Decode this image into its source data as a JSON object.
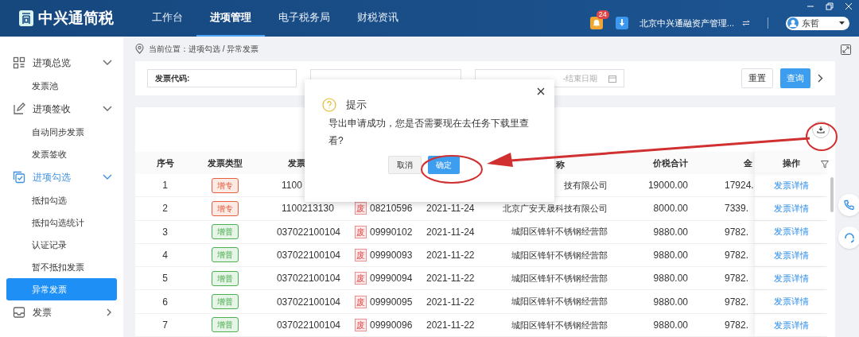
{
  "header": {
    "logo": "中兴通简税",
    "nav": [
      {
        "label": "工作台",
        "selected": false
      },
      {
        "label": "进项管理",
        "selected": true
      },
      {
        "label": "电子税务局",
        "selected": false
      },
      {
        "label": "财税资讯",
        "selected": false
      }
    ],
    "notification_count": "24",
    "company": "北京中兴通融资产管理...",
    "user": "东哲"
  },
  "sidebar": [
    {
      "label": "进项总览",
      "expanded": true,
      "selected": false,
      "children": [
        {
          "label": "发票池",
          "selected": false
        }
      ]
    },
    {
      "label": "进项签收",
      "expanded": true,
      "selected": false,
      "children": [
        {
          "label": "自动同步发票",
          "selected": false
        },
        {
          "label": "发票签收",
          "selected": false
        }
      ]
    },
    {
      "label": "进项勾选",
      "expanded": true,
      "selected": true,
      "children": [
        {
          "label": "抵扣勾选",
          "selected": false
        },
        {
          "label": "抵扣勾选统计",
          "selected": false
        },
        {
          "label": "认证记录",
          "selected": false
        },
        {
          "label": "暂不抵扣发票",
          "selected": false
        },
        {
          "label": "异常发票",
          "selected": true
        }
      ]
    },
    {
      "label": "发票",
      "expanded": false,
      "selected": false
    }
  ],
  "breadcrumb": "当前位置：进项勾选 / 异常发票",
  "filters": [
    {
      "kind": "text",
      "label": "发票代码:"
    },
    {
      "kind": "date",
      "placeholder": "-结束日期"
    }
  ],
  "buttons": [
    {
      "label": "重置",
      "kind": "secondary"
    },
    {
      "label": "查询",
      "kind": "primary"
    }
  ],
  "table": {
    "columns": {
      "index": "序号",
      "type": "发票类型",
      "code": "发票",
      "name": "称",
      "total": "价税合计",
      "amount": "金",
      "action": "操作"
    },
    "rows": [
      {
        "index": "1",
        "type": {
          "label": "增专",
          "color": "#e5603f"
        },
        "code": "1100",
        "name": "技有限公司",
        "total": "19000.00",
        "amount": "17924.",
        "action": "发票详情"
      },
      {
        "index": "2",
        "type": {
          "label": "增专",
          "color": "#e5603f"
        },
        "code": "1100213130",
        "void_mark": "废",
        "number": "08210596",
        "date": "2021-11-24",
        "name": "北京广安天晟科技有限公司",
        "total": "8000.00",
        "amount": "7339.",
        "action": "发票详情"
      },
      {
        "index": "3",
        "type": {
          "label": "增普",
          "color": "#4caf50"
        },
        "code": "037022100104",
        "void_mark": "废",
        "number": "09990102",
        "date": "2021-11-24",
        "name": "城阳区锋轩不锈钢经营部",
        "total": "9880.00",
        "amount": "9782.",
        "action": "发票详情"
      },
      {
        "index": "4",
        "type": {
          "label": "增普",
          "color": "#4caf50"
        },
        "code": "037022100104",
        "void_mark": "废",
        "number": "09990093",
        "date": "2021-11-22",
        "name": "城阳区锋轩不锈钢经营部",
        "total": "9880.00",
        "amount": "9782.",
        "action": "发票详情"
      },
      {
        "index": "5",
        "type": {
          "label": "增普",
          "color": "#4caf50"
        },
        "code": "037022100104",
        "void_mark": "废",
        "number": "09990094",
        "date": "2021-11-22",
        "name": "城阳区锋轩不锈钢经营部",
        "total": "9880.00",
        "amount": "9782.",
        "action": "发票详情"
      },
      {
        "index": "6",
        "type": {
          "label": "增普",
          "color": "#4caf50"
        },
        "code": "037022100104",
        "void_mark": "废",
        "number": "09990095",
        "date": "2021-11-22",
        "name": "城阳区锋轩不锈钢经营部",
        "total": "9880.00",
        "amount": "9782.",
        "action": "发票详情"
      },
      {
        "index": "7",
        "type": {
          "label": "增普",
          "color": "#4caf50"
        },
        "code": "037022100104",
        "void_mark": "废",
        "number": "09990096",
        "date": "2021-11-22",
        "name": "城阳区锋轩不锈钢经营部",
        "total": "9880.00",
        "amount": "9782.",
        "action": "发票详情"
      }
    ]
  },
  "dialog": {
    "title": "提示",
    "message": "导出申请成功，您是否需要现在去任务下载里查看?",
    "buttons": [
      {
        "label": "取消",
        "kind": "secondary"
      },
      {
        "label": "确定",
        "kind": "primary"
      }
    ]
  }
}
